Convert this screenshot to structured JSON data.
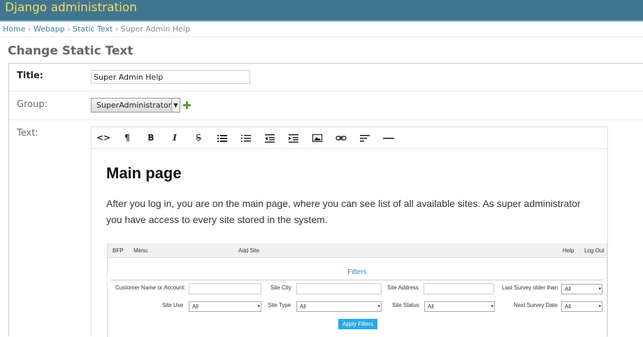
{
  "header": {
    "branding": "Django administration"
  },
  "breadcrumbs": {
    "home": "Home",
    "app": "Webapp",
    "model": "Static Text",
    "current": "Super Admin Help",
    "separator": "›"
  },
  "page_title": "Change Static Text",
  "form": {
    "title_label": "Title:",
    "title_value": "Super Admin Help",
    "group_label": "Group:",
    "group_value": "SuperAdministrators",
    "text_label": "Text:"
  },
  "toolbar": {
    "html": "<>",
    "paragraph": "¶",
    "bold": "B",
    "italic": "I",
    "strike": "S",
    "icons": [
      "code-icon",
      "paragraph-icon",
      "bold-icon",
      "italic-icon",
      "strikethrough-icon",
      "unordered-list-icon",
      "ordered-list-icon",
      "outdent-icon",
      "indent-icon",
      "image-icon",
      "link-icon",
      "align-icon",
      "horizontal-rule-icon"
    ]
  },
  "content": {
    "heading": "Main page",
    "paragraph": "After you log in, you are on the main page, where you can see list of all available sites. As super administrator you have access to every site stored in the system."
  },
  "embed": {
    "nav": {
      "brand": "BFP",
      "menu": "Menu",
      "add_site": "Add Site",
      "help": "Help",
      "logout": "Log Out"
    },
    "filters_title": "Filters",
    "labels": {
      "customer": "Customer Name or Account:",
      "city": "Site City",
      "address": "Site Address",
      "last_survey": "Last Survey older than",
      "site_use": "Site Use",
      "site_type": "Site Type",
      "site_status": "Site Status",
      "next_survey": "Next Survey Date"
    },
    "select_all": "All",
    "apply": "Apply Filters"
  },
  "colors": {
    "header_bg": "#417690",
    "branding": "#f5dd5d",
    "link": "#447e9b",
    "accent_blue": "#2aa8e8"
  }
}
